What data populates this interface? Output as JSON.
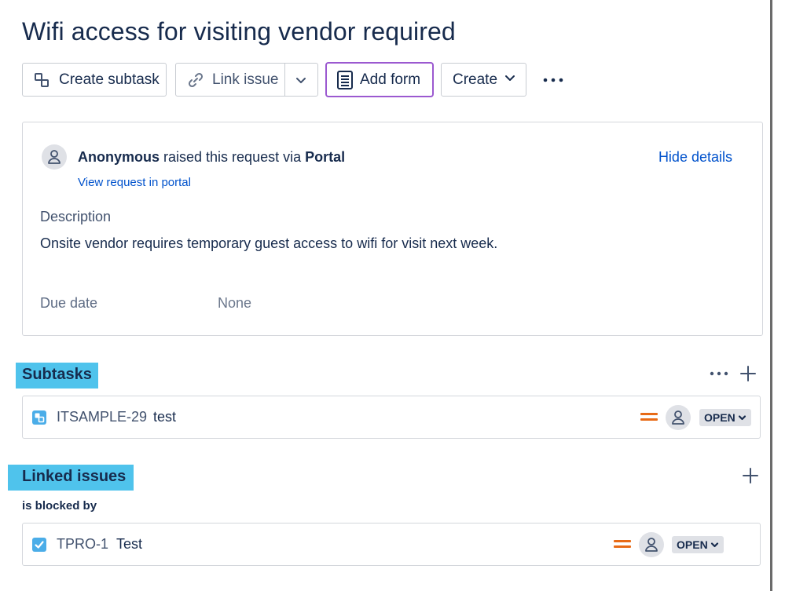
{
  "issue": {
    "title": "Wifi access for visiting vendor required"
  },
  "toolbar": {
    "create_subtask": "Create subtask",
    "link_issue": "Link issue",
    "add_form": "Add form",
    "create": "Create"
  },
  "request": {
    "reporter": "Anonymous",
    "raised_via_text": " raised this request via ",
    "channel": "Portal",
    "view_portal_link": "View request in portal",
    "hide_details": "Hide details",
    "description_label": "Description",
    "description_text": "Onsite vendor requires temporary guest access to wifi for visit next week.",
    "due_date_label": "Due date",
    "due_date_value": "None"
  },
  "subtasks": {
    "heading": "Subtasks",
    "items": [
      {
        "key": "ITSAMPLE-29",
        "summary": "test",
        "priority": "medium",
        "status": "OPEN"
      }
    ]
  },
  "linked_issues": {
    "heading": "Linked issues",
    "relation_label": "is blocked by",
    "items": [
      {
        "key": "TPRO-1",
        "summary": "Test",
        "priority": "medium",
        "status": "OPEN"
      }
    ]
  },
  "colors": {
    "highlight": "#4fc3ec",
    "link": "#0052cc",
    "priority_medium": "#e86b17",
    "add_form_border": "#9b59d0",
    "status_bg": "#dfe1e6"
  }
}
